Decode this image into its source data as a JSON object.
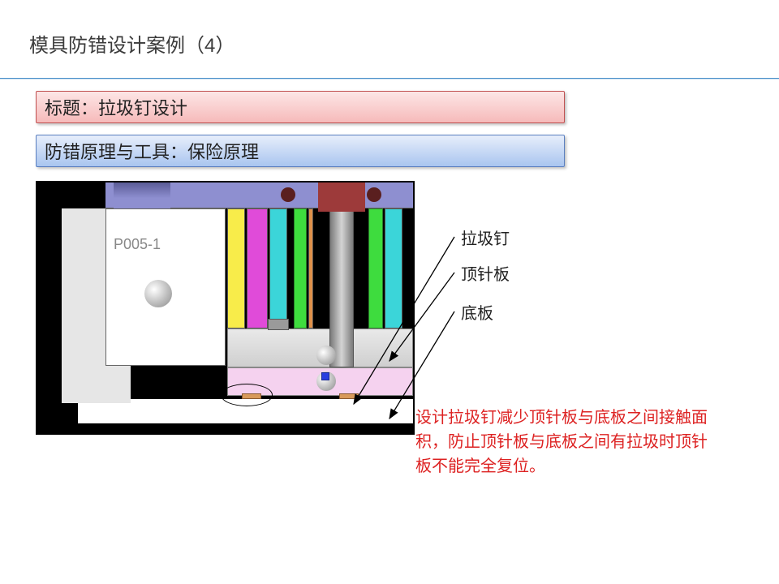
{
  "page": {
    "title": "模具防错设计案例（4）"
  },
  "banners": {
    "title_label": "标题：拉圾钉设计",
    "principle_label": "防错原理与工具：保险原理"
  },
  "figure": {
    "part_id": "P005-1"
  },
  "callouts": {
    "a": "拉圾钉",
    "b": "顶针板",
    "c": "底板"
  },
  "note": "设计拉圾钉减少顶针板与底板之间接触面积，防止顶针板与底板之间有拉圾时顶针板不能完全复位。"
}
